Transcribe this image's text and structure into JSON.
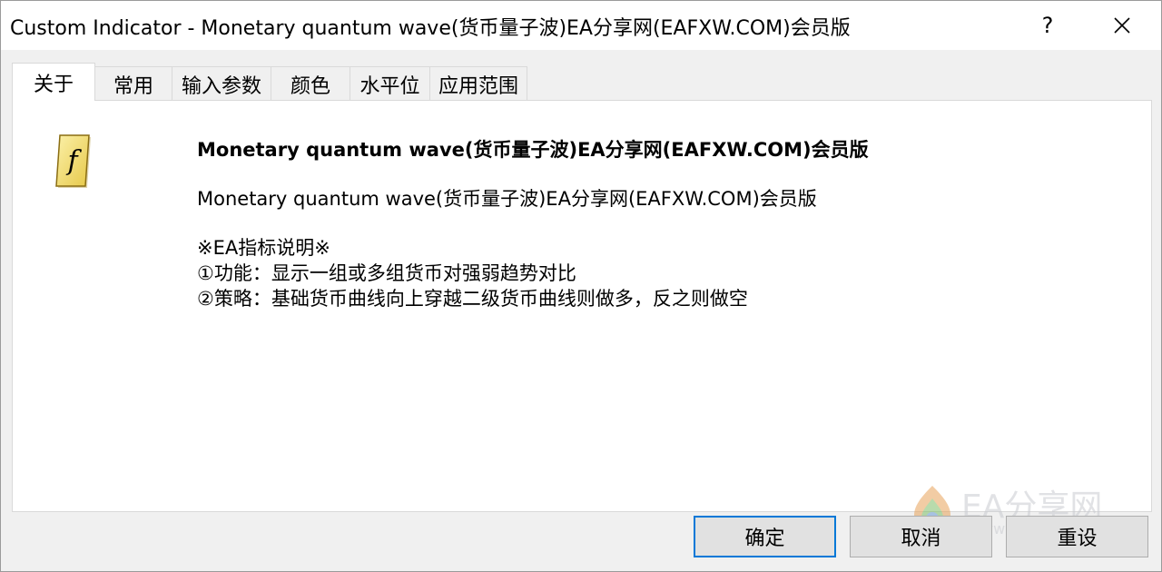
{
  "window": {
    "title": "Custom Indicator - Monetary quantum wave(货币量子波)EA分享网(EAFXW.COM)会员版",
    "help_label": "?",
    "close_label": "✕"
  },
  "tabs": [
    {
      "label": "关于",
      "active": true
    },
    {
      "label": "常用",
      "active": false
    },
    {
      "label": "输入参数",
      "active": false
    },
    {
      "label": "颜色",
      "active": false
    },
    {
      "label": "水平位",
      "active": false
    },
    {
      "label": "应用范围",
      "active": false
    }
  ],
  "about": {
    "icon": "function-script-icon",
    "heading": "Monetary quantum wave(货币量子波)EA分享网(EAFXW.COM)会员版",
    "subtitle": "Monetary quantum wave(货币量子波)EA分享网(EAFXW.COM)会员版",
    "description": [
      "※EA指标说明※",
      "①功能：显示一组或多组货币对强弱趋势对比",
      "②策略：基础货币曲线向上穿越二级货币曲线则做多，反之则做空"
    ]
  },
  "buttons": {
    "ok": "确定",
    "cancel": "取消",
    "reset": "重设"
  },
  "watermark": {
    "text": "EA分享网",
    "url": "www.eafxw.com"
  },
  "colors": {
    "accent": "#0078d7",
    "icon_fill": "#f6e58d"
  }
}
